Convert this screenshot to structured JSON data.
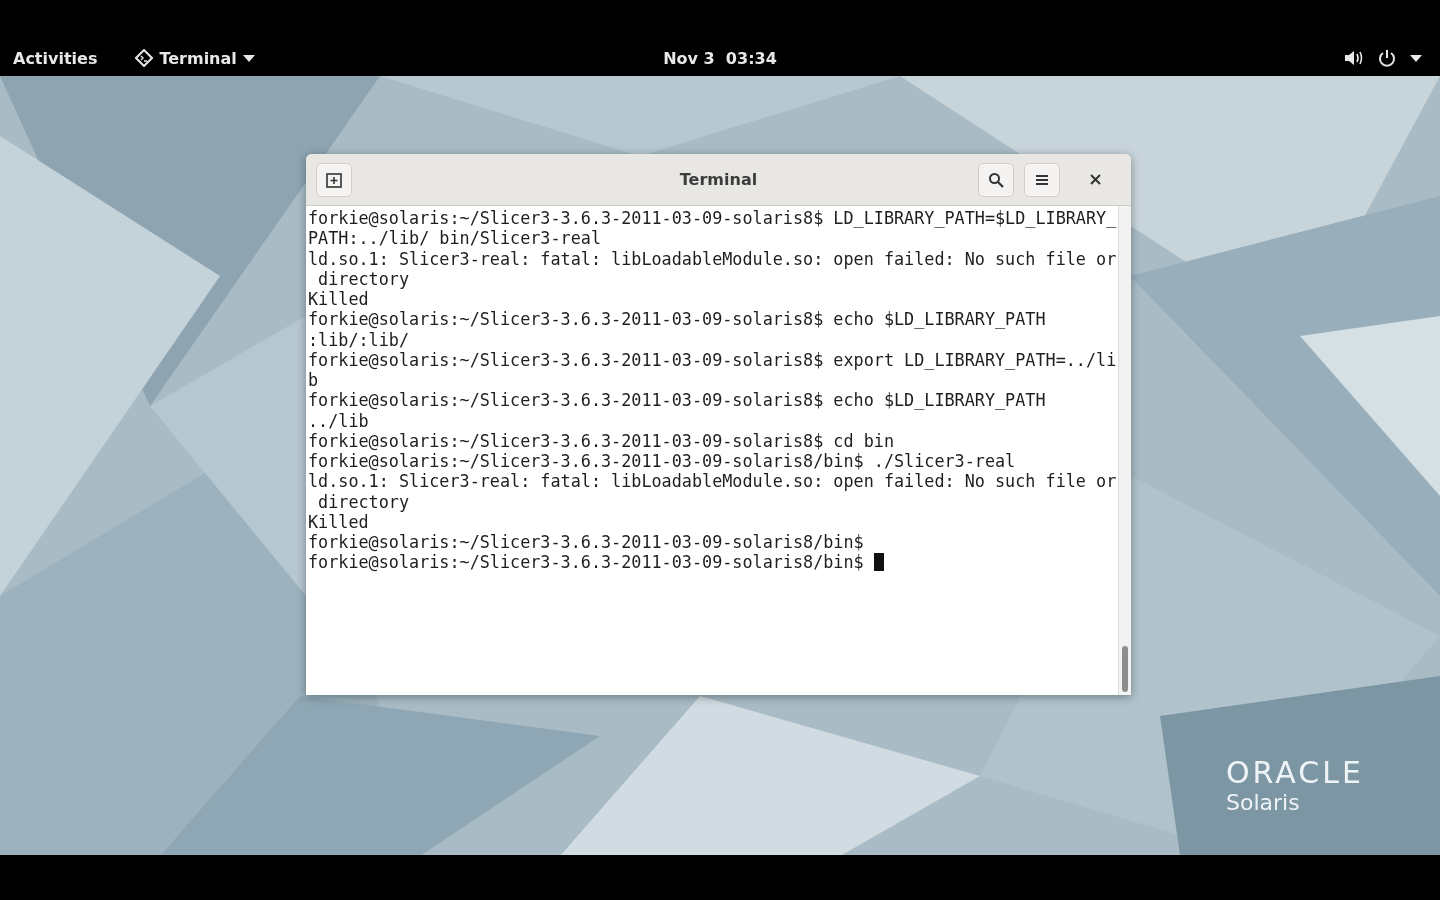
{
  "top_bar": {
    "activities": "Activities",
    "app_menu": "Terminal",
    "clock": "Nov 3  03:34"
  },
  "window": {
    "title": "Terminal",
    "lines": [
      "forkie@solaris:~/Slicer3-3.6.3-2011-03-09-solaris8$ LD_LIBRARY_PATH=$LD_LIBRARY_",
      "PATH:../lib/ bin/Slicer3-real",
      "ld.so.1: Slicer3-real: fatal: libLoadableModule.so: open failed: No such file or",
      " directory",
      "Killed",
      "forkie@solaris:~/Slicer3-3.6.3-2011-03-09-solaris8$ echo $LD_LIBRARY_PATH",
      ":lib/:lib/",
      "forkie@solaris:~/Slicer3-3.6.3-2011-03-09-solaris8$ export LD_LIBRARY_PATH=../li",
      "b",
      "forkie@solaris:~/Slicer3-3.6.3-2011-03-09-solaris8$ echo $LD_LIBRARY_PATH",
      "../lib",
      "forkie@solaris:~/Slicer3-3.6.3-2011-03-09-solaris8$ cd bin",
      "forkie@solaris:~/Slicer3-3.6.3-2011-03-09-solaris8/bin$ ./Slicer3-real",
      "ld.so.1: Slicer3-real: fatal: libLoadableModule.so: open failed: No such file or",
      " directory",
      "Killed",
      "forkie@solaris:~/Slicer3-3.6.3-2011-03-09-solaris8/bin$ ",
      "forkie@solaris:~/Slicer3-3.6.3-2011-03-09-solaris8/bin$ "
    ]
  },
  "wallpaper_logo": {
    "brand": "ORACLE",
    "product": "Solaris"
  }
}
